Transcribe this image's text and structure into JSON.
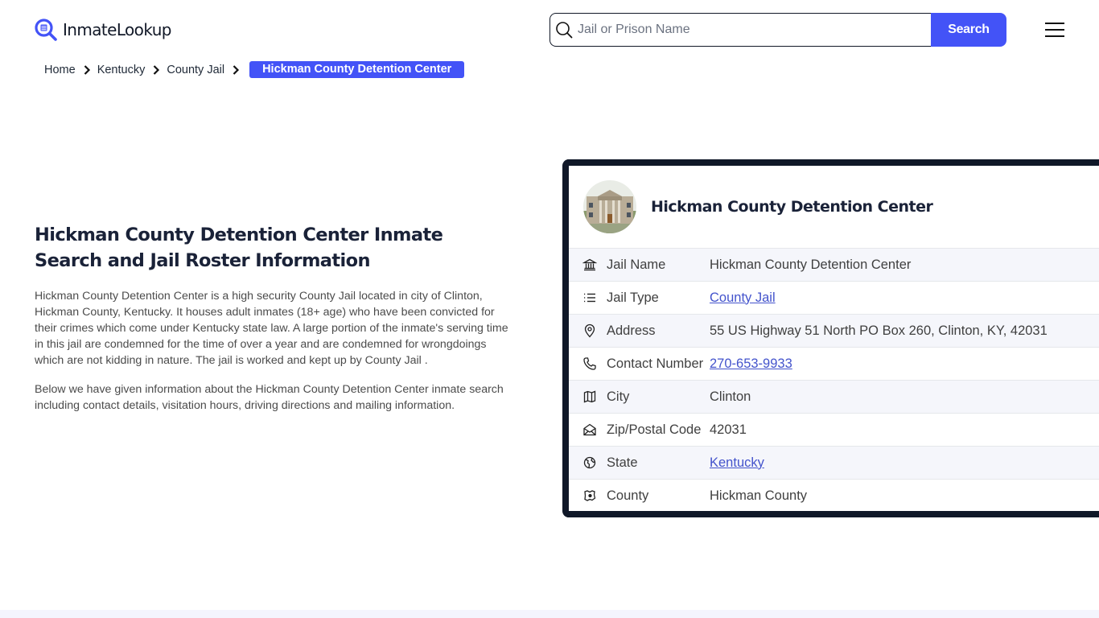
{
  "header": {
    "logo_text": "InmateLookup",
    "search": {
      "placeholder": "Jail or Prison Name",
      "value": "",
      "button_label": "Search"
    },
    "menu_icon": "hamburger-menu-icon"
  },
  "breadcrumb": {
    "items": [
      "Home",
      "Kentucky",
      "County Jail"
    ],
    "current": "Hickman County Detention Center"
  },
  "intro": {
    "title": "Hickman County Detention Center Inmate Search and Jail Roster Information",
    "paragraphs": [
      "Hickman County Detention Center is a high security County Jail located in city of Clinton, Hickman County, Kentucky. It houses adult inmates (18+ age) who have been convicted for their crimes which come under Kentucky state law. A large portion of the inmate's serving time in this jail are condemned for the time of over a year and are condemned for wrongdoings which are not kidding in nature. The jail is worked and kept up by County Jail .",
      "Below we have given information about the Hickman County Detention Center inmate search including contact details, visitation hours, driving directions and mailing information."
    ]
  },
  "card": {
    "title": "Hickman County Detention Center",
    "rows": [
      {
        "icon": "bank-icon",
        "label": "Jail Name",
        "value": "Hickman County Detention Center",
        "link": false
      },
      {
        "icon": "list-icon",
        "label": "Jail Type",
        "value": "County Jail",
        "link": true
      },
      {
        "icon": "map-pin-icon",
        "label": "Address",
        "value": "55 US Highway 51 North PO Box 260, Clinton, KY, 42031",
        "link": false
      },
      {
        "icon": "phone-icon",
        "label": "Contact Number",
        "value": "270-653-9933",
        "link": true
      },
      {
        "icon": "map-icon",
        "label": "City",
        "value": "Clinton",
        "link": false
      },
      {
        "icon": "mail-open-icon",
        "label": "Zip/Postal Code",
        "value": "42031",
        "link": false
      },
      {
        "icon": "globe-icon",
        "label": "State",
        "value": "Kentucky",
        "link": true
      },
      {
        "icon": "county-map-icon",
        "label": "County",
        "value": "Hickman County",
        "link": false
      }
    ]
  },
  "colors": {
    "accent": "#4353f7",
    "card_border": "#101828",
    "link": "#4353cc",
    "row_alt": "#f5f6fb"
  }
}
